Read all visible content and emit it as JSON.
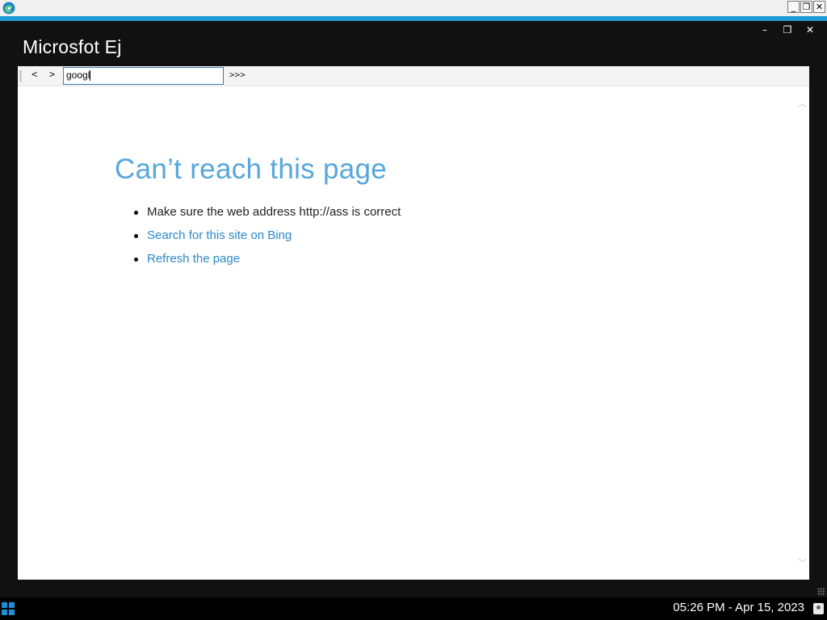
{
  "os_window": {
    "controls": {
      "minimize": "_",
      "restore": "❐",
      "close": "✕"
    }
  },
  "app": {
    "title": "Microsfot Ej",
    "controls": {
      "minimize": "–",
      "restore": "❐",
      "close": "✕"
    }
  },
  "toolbar": {
    "back_label": "<",
    "forward_label": ">",
    "address_value": "googl",
    "go_label": ">>>"
  },
  "error_page": {
    "title": "Can’t reach this page",
    "items": [
      {
        "text": "Make sure the web address http://ass is correct",
        "link": false
      },
      {
        "text": "Search for this site on Bing",
        "link": true
      },
      {
        "text": "Refresh the page",
        "link": true
      }
    ]
  },
  "scrollbar": {
    "up": "︿",
    "down": "﹀"
  },
  "taskbar": {
    "clock": "05:26 PM - Apr 15, 2023"
  },
  "colors": {
    "accent": "#1e9ad6",
    "title_blue": "#56a7dc",
    "link_blue": "#2b88c9",
    "frame": "#111111",
    "start_icon": "#1e8fd8"
  },
  "icons": {
    "app_icon": "edge-icon",
    "start_icon": "windows-start-icon",
    "tray_icon": "user-tray-icon"
  }
}
